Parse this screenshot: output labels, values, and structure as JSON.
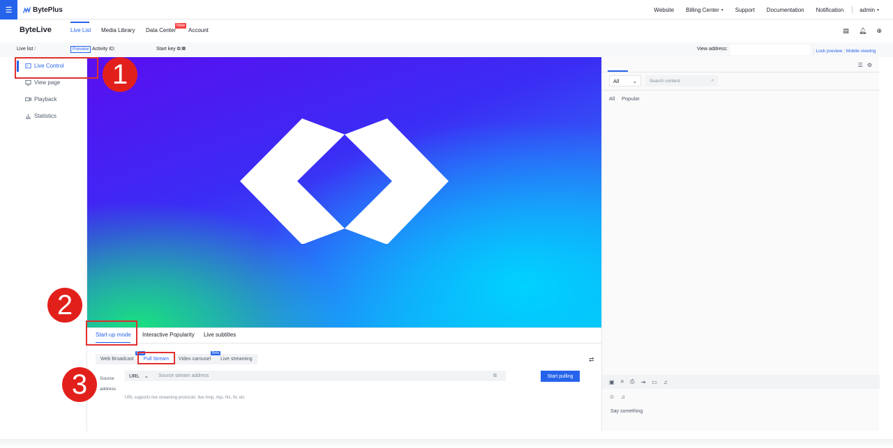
{
  "topbar": {
    "menu_icon": "hamburger-icon",
    "brand": "BytePlus",
    "links": [
      "Website",
      "Billing Center",
      "Support",
      "Documentation",
      "Notification"
    ],
    "user": "admin"
  },
  "subnav": {
    "product": "ByteLive",
    "tabs": [
      "Live List",
      "Media Library",
      "Data Center",
      "Account"
    ],
    "new_badge": "New"
  },
  "breadcrumb": {
    "live_list": "Live list",
    "separator": "/",
    "preview": "Preview",
    "activity_id": "Activity ID:",
    "start_key": "Start key",
    "view_address": "View address:",
    "lock_preview": "Lock preview",
    "mobile_viewing": "Mobile viewing"
  },
  "sidebar": {
    "items": [
      {
        "label": "Live Control",
        "icon": "control-icon"
      },
      {
        "label": "View page",
        "icon": "monitor-icon"
      },
      {
        "label": "Playback",
        "icon": "video-icon"
      },
      {
        "label": "Statistics",
        "icon": "bar-chart-icon"
      }
    ]
  },
  "panel": {
    "tabs": [
      "Start-up mode",
      "Interactive Popularity",
      "Live subtitles"
    ],
    "modes": [
      "Web Broadcast",
      "Pull Stream",
      "Video carousel",
      "Live streaming"
    ],
    "beta": "Beta",
    "source_label": "Source address",
    "url_type": "URL",
    "url_placeholder": "Source stream address",
    "hint": "URL supports live streaming protocols: live rtmp, rtsp, hls, flv, etc",
    "start_button": "Start pulling"
  },
  "right_panel": {
    "filter_select": "All",
    "search_placeholder": "Search content",
    "filters": [
      "All",
      "Popular"
    ],
    "say_placeholder": "Say something"
  },
  "annotations": [
    "1",
    "2",
    "3"
  ],
  "colors": {
    "accent": "#2563eb",
    "annotation": "#e2201b",
    "badge": "#f53f3f"
  }
}
